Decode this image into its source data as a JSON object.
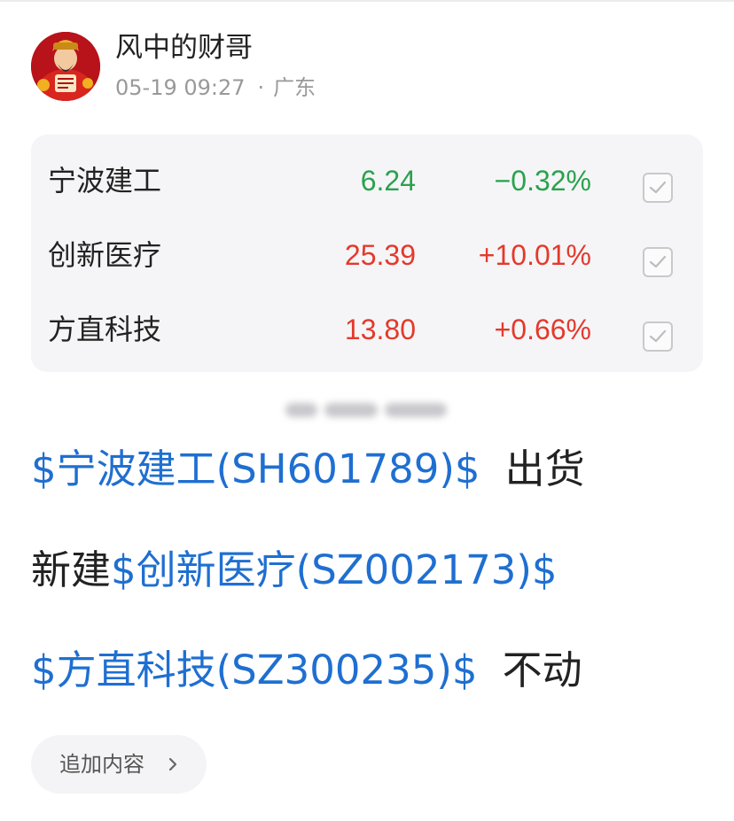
{
  "post": {
    "author": "风中的财哥",
    "time": "05-19 09:27",
    "separator": "·",
    "location": "广东"
  },
  "stocks": [
    {
      "name": "宁波建工",
      "price": "6.24",
      "change": "−0.32%",
      "direction": "down",
      "checked": true
    },
    {
      "name": "创新医疗",
      "price": "25.39",
      "change": "+10.01%",
      "direction": "up",
      "checked": true
    },
    {
      "name": "方直科技",
      "price": "13.80",
      "change": "+0.66%",
      "direction": "up",
      "checked": true
    }
  ],
  "content": {
    "line1": {
      "link": "$宁波建工(SH601789)$",
      "text": "出货"
    },
    "line2": {
      "text": "新建",
      "link": "$创新医疗(SZ002173)$"
    },
    "line3": {
      "link": "$方直科技(SZ300235)$",
      "text": "不动"
    }
  },
  "actions": {
    "add_content_label": "追加内容",
    "chevron_icon": "chevron-right-icon"
  },
  "colors": {
    "link": "#1f6fd1",
    "up": "#e4392b",
    "down": "#2aa24d",
    "card_bg": "#f5f5f7",
    "muted": "#999999"
  }
}
